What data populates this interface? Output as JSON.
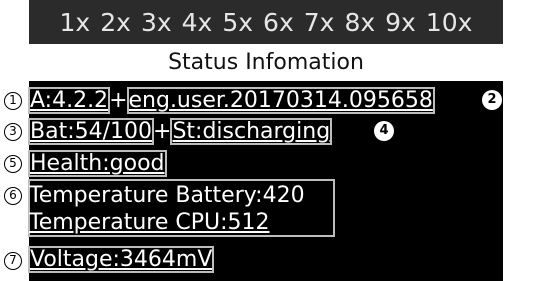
{
  "zoom_bar": {
    "levels": [
      "1x",
      "2x",
      "3x",
      "4x",
      "5x",
      "6x",
      "7x",
      "8x",
      "9x",
      "10x"
    ]
  },
  "header": {
    "title": "Status Infomation"
  },
  "status": {
    "android_version": "A:4.2.2",
    "build": "eng.user.20170314.095658",
    "battery": "Bat:54/100",
    "state": "St:discharging",
    "health": "Health:good",
    "temperature_battery": "Temperature Battery:420",
    "temperature_cpu": "Temperature CPU:512",
    "voltage": "Voltage:3464mV",
    "separator": "+"
  },
  "callouts": {
    "c1": "1",
    "c2": "2",
    "c3": "3",
    "c4": "4",
    "c5": "5",
    "c6": "6",
    "c7": "7"
  },
  "colors": {
    "zoom_bar_bg": "#2b2b2b",
    "panel_bg": "#000000",
    "box_outline": "#bdbdbd"
  }
}
